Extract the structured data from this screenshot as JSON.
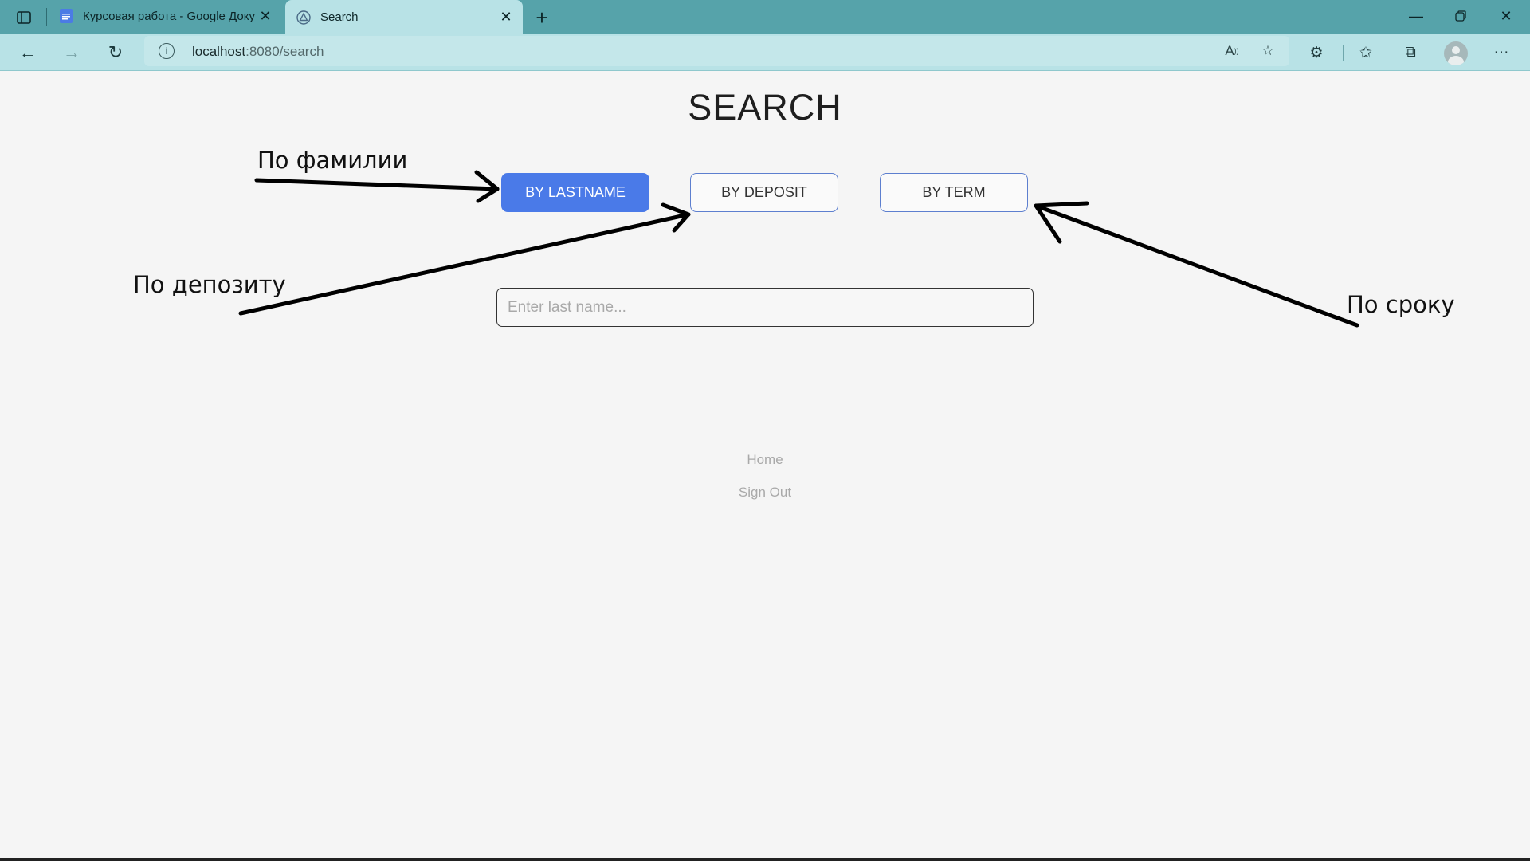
{
  "browser": {
    "tabs": [
      {
        "title": "Курсовая работа - Google Доку",
        "icon": "google-docs-icon",
        "active": false
      },
      {
        "title": "Search",
        "icon": "app-favicon",
        "active": true
      }
    ],
    "address": {
      "host": "localhost",
      "path": ":8080/search"
    },
    "theme_color": "#56a3aa"
  },
  "page": {
    "title": "SEARCH",
    "buttons": [
      {
        "label": "BY LASTNAME",
        "active": true
      },
      {
        "label": "BY DEPOSIT",
        "active": false
      },
      {
        "label": "BY TERM",
        "active": false
      }
    ],
    "search": {
      "placeholder": "Enter last name...",
      "value": ""
    },
    "links": {
      "home": "Home",
      "sign_out": "Sign Out"
    },
    "accent_color": "#4a7ae8"
  },
  "annotations": {
    "by_lastname": "По фамилии",
    "by_deposit": "По депозиту",
    "by_term": "По сроку"
  }
}
